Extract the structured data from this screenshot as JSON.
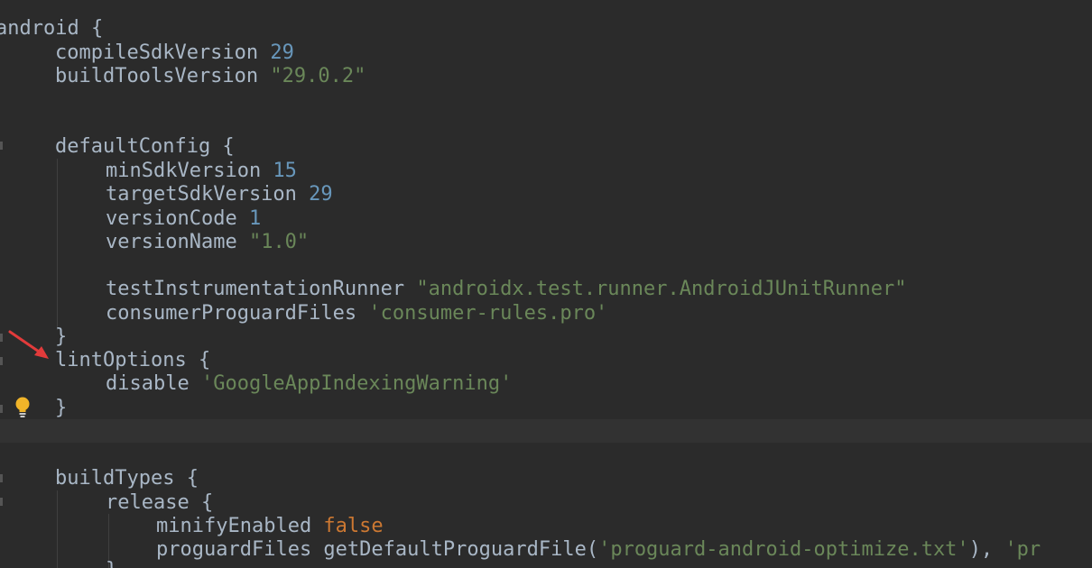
{
  "editor": {
    "colors": {
      "background": "#2b2b2b",
      "text": "#a9b7c6",
      "number": "#6897bb",
      "string": "#6a8759",
      "keyword": "#cc7832",
      "caret_row": "#323232",
      "annotation_arrow": "#e23b3b",
      "bulb": "#f0b429"
    },
    "icons": {
      "lightbulb": "intention-lightbulb-icon",
      "arrow": "annotation-arrow-icon"
    },
    "lines": [
      {
        "t0": "android {"
      },
      {
        "t0": "compileSdkVersion",
        "t1": " 29"
      },
      {
        "t0": "buildToolsVersion",
        "t1": " \"29.0.2\""
      },
      {
        "t0": "defaultConfig {"
      },
      {
        "t0": "minSdkVersion",
        "t1": " 15"
      },
      {
        "t0": "targetSdkVersion",
        "t1": " 29"
      },
      {
        "t0": "versionCode",
        "t1": " 1"
      },
      {
        "t0": "versionName",
        "t1": " \"1.0\""
      },
      {
        "t0": "testInstrumentationRunner",
        "t1": " \"androidx.test.runner.AndroidJUnitRunner\""
      },
      {
        "t0": "consumerProguardFiles",
        "t1": " 'consumer-rules.pro'"
      },
      {
        "t0": "}"
      },
      {
        "t0": "lintOptions {"
      },
      {
        "t0": "disable",
        "t1": " 'GoogleAppIndexingWarning'"
      },
      {
        "t0": "}"
      },
      {
        "t0": "buildTypes {"
      },
      {
        "t0": "release {"
      },
      {
        "t0": "minifyEnabled",
        "t1": " false"
      },
      {
        "t0": "proguardFiles getDefaultProguardFile(",
        "t1": "'proguard-android-optimize.txt'",
        "t2": "), ",
        "t3": "'pr"
      },
      {
        "t0": "}"
      }
    ]
  }
}
